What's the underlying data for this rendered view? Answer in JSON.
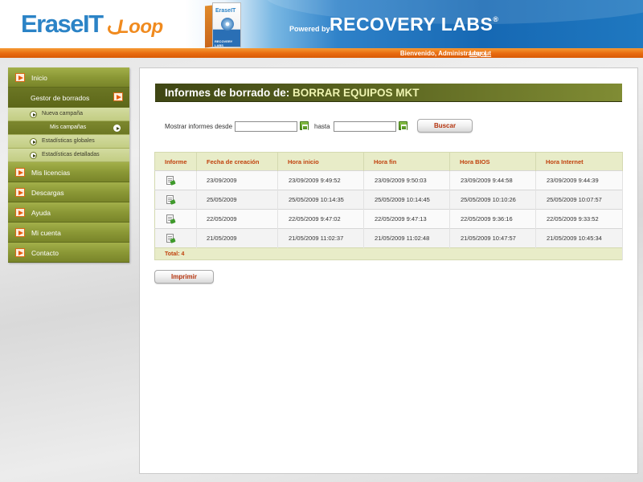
{
  "header": {
    "logo_text": "EraseIT",
    "logo_loop": "Loop",
    "powered_by": "Powered by",
    "brand": "RECOVERY LABS",
    "brand_mark": "®",
    "box_title": "EraseIT",
    "box_brand": "RECOVERY LABS"
  },
  "topbar": {
    "welcome": "Bienvenido, Administrador",
    "separator": "|",
    "logout": "Logout"
  },
  "sidebar": {
    "items": [
      {
        "label": "Inicio"
      },
      {
        "label": "Gestor de borrados"
      },
      {
        "label": "Mis licencias"
      },
      {
        "label": "Descargas"
      },
      {
        "label": "Ayuda"
      },
      {
        "label": "Mi cuenta"
      },
      {
        "label": "Contacto"
      }
    ],
    "subitems": [
      {
        "label": "Nueva campaña"
      },
      {
        "label": "Mis campañas"
      },
      {
        "label": "Estadísticas globales"
      },
      {
        "label": "Estadísticas detalladas"
      }
    ]
  },
  "main": {
    "title_prefix": "Informes de borrado de:",
    "title_name": "BORRAR EQUIPOS MKT",
    "filter": {
      "from_label": "Mostrar informes desde",
      "to_label": "hasta",
      "from_value": "",
      "to_value": "",
      "search_label": "Buscar"
    },
    "table": {
      "headers": [
        "Informe",
        "Fecha de creación",
        "Hora inicio",
        "Hora fin",
        "Hora BIOS",
        "Hora Internet"
      ],
      "rows": [
        [
          "",
          "23/09/2009",
          "23/09/2009 9:49:52",
          "23/09/2009 9:50:03",
          "23/09/2009 9:44:58",
          "23/09/2009 9:44:39"
        ],
        [
          "",
          "25/05/2009",
          "25/05/2009 10:14:35",
          "25/05/2009 10:14:45",
          "25/05/2009 10:10:26",
          "25/05/2009 10:07:57"
        ],
        [
          "",
          "22/05/2009",
          "22/05/2009 9:47:02",
          "22/05/2009 9:47:13",
          "22/05/2009 9:36:16",
          "22/05/2009 9:33:52"
        ],
        [
          "",
          "21/05/2009",
          "21/05/2009 11:02:37",
          "21/05/2009 11:02:48",
          "21/05/2009 10:47:57",
          "21/05/2009 10:45:34"
        ]
      ],
      "total": "Total: 4"
    },
    "print_label": "Imprimir"
  },
  "colors": {
    "accent_orange": "#e8590c",
    "olive": "#7f8a2c",
    "brand_blue": "#1668b3"
  },
  "icons": {
    "menu_arrow": "play-square-icon",
    "sub_arrow": "play-circle-icon",
    "report": "document-check-icon",
    "calendar": "calendar-icon"
  }
}
